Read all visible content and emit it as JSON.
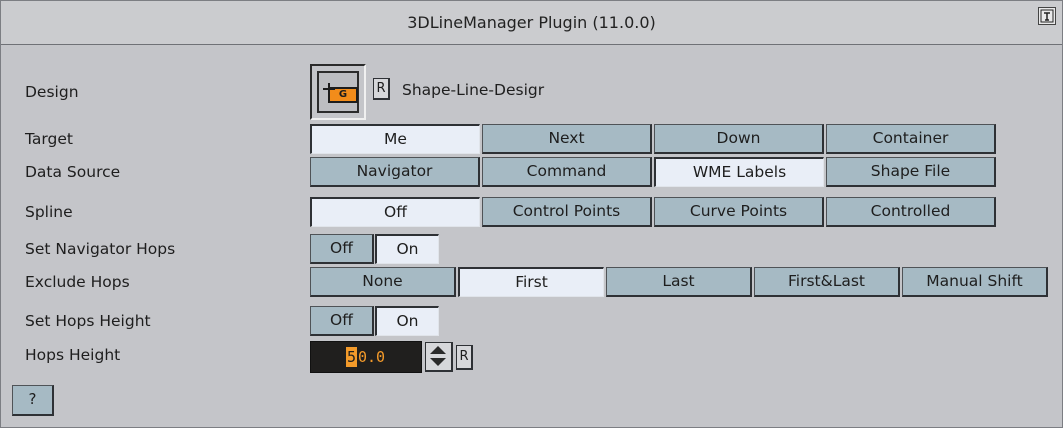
{
  "window": {
    "title": "3DLineManager Plugin (11.0.0)"
  },
  "design": {
    "label": "Design",
    "thumb_letter": "G",
    "reset_label": "R",
    "name": "Shape-Line-Desigr"
  },
  "target": {
    "label": "Target",
    "options": [
      "Me",
      "Next",
      "Down",
      "Container"
    ],
    "selected": "Me"
  },
  "data_source": {
    "label": "Data Source",
    "options": [
      "Navigator",
      "Command",
      "WME Labels",
      "Shape File"
    ],
    "selected": "WME Labels"
  },
  "spline": {
    "label": "Spline",
    "options": [
      "Off",
      "Control Points",
      "Curve Points",
      "Controlled"
    ],
    "selected": "Off"
  },
  "set_navigator_hops": {
    "label": "Set Navigator Hops",
    "options": [
      "Off",
      "On"
    ],
    "selected": "On"
  },
  "exclude_hops": {
    "label": "Exclude Hops",
    "options": [
      "None",
      "First",
      "Last",
      "First&Last",
      "Manual Shift"
    ],
    "selected": "First"
  },
  "set_hops_height": {
    "label": "Set Hops Height",
    "options": [
      "Off",
      "On"
    ],
    "selected": "On"
  },
  "hops_height": {
    "label": "Hops Height",
    "value_first": "5",
    "value_rest": "0.0",
    "reset_label": "R"
  },
  "help": {
    "label": "?"
  }
}
